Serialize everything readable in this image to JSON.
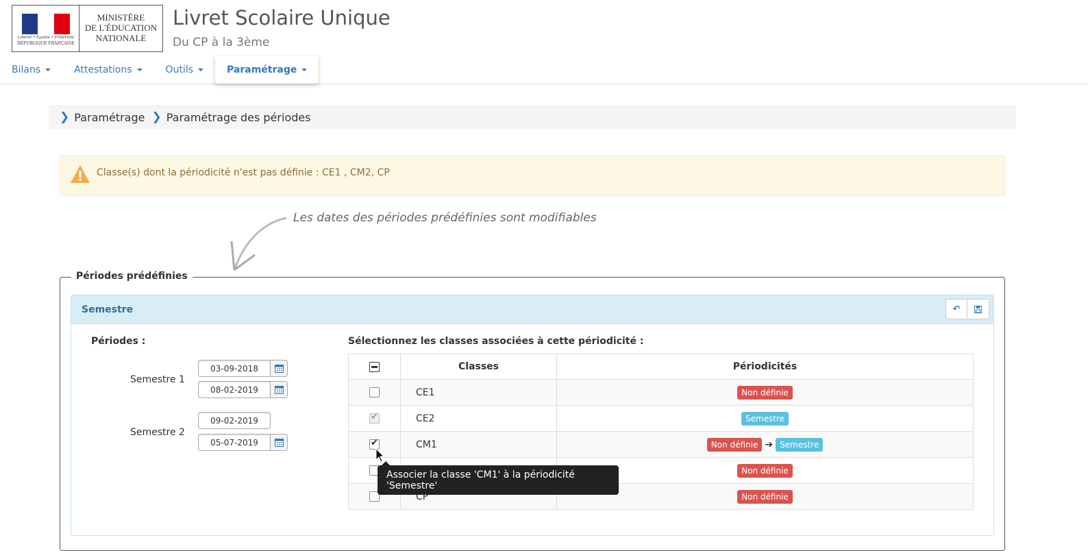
{
  "logo": {
    "motto": "Liberté • Égalité • Fraternité",
    "republic": "RÉPUBLIQUE FRANÇAISE",
    "ministry": [
      "MINISTÈRE",
      "DE L'ÉDUCATION",
      "NATIONALE"
    ]
  },
  "app": {
    "title": "Livret Scolaire Unique",
    "subtitle": "Du CP à la 3ème"
  },
  "nav": [
    {
      "label": "Bilans"
    },
    {
      "label": "Attestations"
    },
    {
      "label": "Outils"
    },
    {
      "label": "Paramétrage",
      "active": true
    }
  ],
  "breadcrumb": [
    "Paramétrage",
    "Paramétrage des périodes"
  ],
  "alert": {
    "text": "Classe(s) dont la périodicité n'est pas définie : CE1 , CM2, CP"
  },
  "hint": "Les dates des périodes prédéfinies sont modifiables",
  "fieldset": {
    "legend": "Périodes prédéfinies"
  },
  "panel": {
    "title": "Semestre"
  },
  "periods": {
    "label": "Périodes :",
    "items": [
      {
        "name": "Semestre 1",
        "start": "03-09-2018",
        "end": "08-02-2019"
      },
      {
        "name": "Semestre 2",
        "start": "09-02-2019",
        "end": "05-07-2019"
      }
    ]
  },
  "classes": {
    "title": "Sélectionnez les classes associées à cette périodicité :",
    "headers": [
      "Classes",
      "Périodicités"
    ],
    "rows": [
      {
        "name": "CE1",
        "badges": [
          "Non définie"
        ]
      },
      {
        "name": "CE2",
        "badges": [
          "Semestre"
        ]
      },
      {
        "name": "CM1",
        "badges": [
          "Non définie",
          "Semestre"
        ]
      },
      {
        "name": "CM2",
        "badges": [
          "Non définie"
        ]
      },
      {
        "name": "CP",
        "badges": [
          "Non définie"
        ]
      }
    ]
  },
  "tooltip": "Associer la classe 'CM1' à la périodicité 'Semestre'",
  "colors": {
    "link": "#337ab7",
    "danger": "#d9534f",
    "info": "#5bc0de",
    "alert_bg": "#fcf8e3",
    "panel_head": "#d9edf7"
  }
}
